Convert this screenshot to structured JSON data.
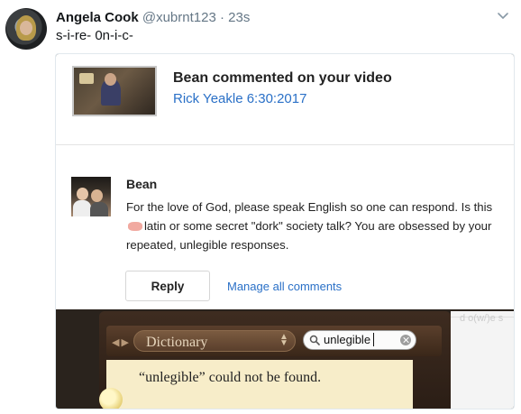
{
  "tweet": {
    "display_name": "Angela Cook",
    "handle": "@xubrnt123",
    "separator": "·",
    "time": "23s",
    "text": "s-i-re- 0n-i-c-"
  },
  "notification": {
    "title": "Bean commented on your video",
    "video_title": "Rick Yeakle 6:30:2017"
  },
  "comment": {
    "author": "Bean",
    "text_part1": "For the love of God, please speak English so one can respond. Is this",
    "text_part2": "latin or some secret \"dork\" society talk? You are obsessed by your repeated, unlegible responses.",
    "reply_label": "Reply",
    "manage_label": "Manage all comments"
  },
  "background_edge_text": "d o(w/)e s",
  "dictionary": {
    "source_label": "Dictionary",
    "search_value": "unlegible",
    "result_text": "“unlegible” could not be found."
  }
}
